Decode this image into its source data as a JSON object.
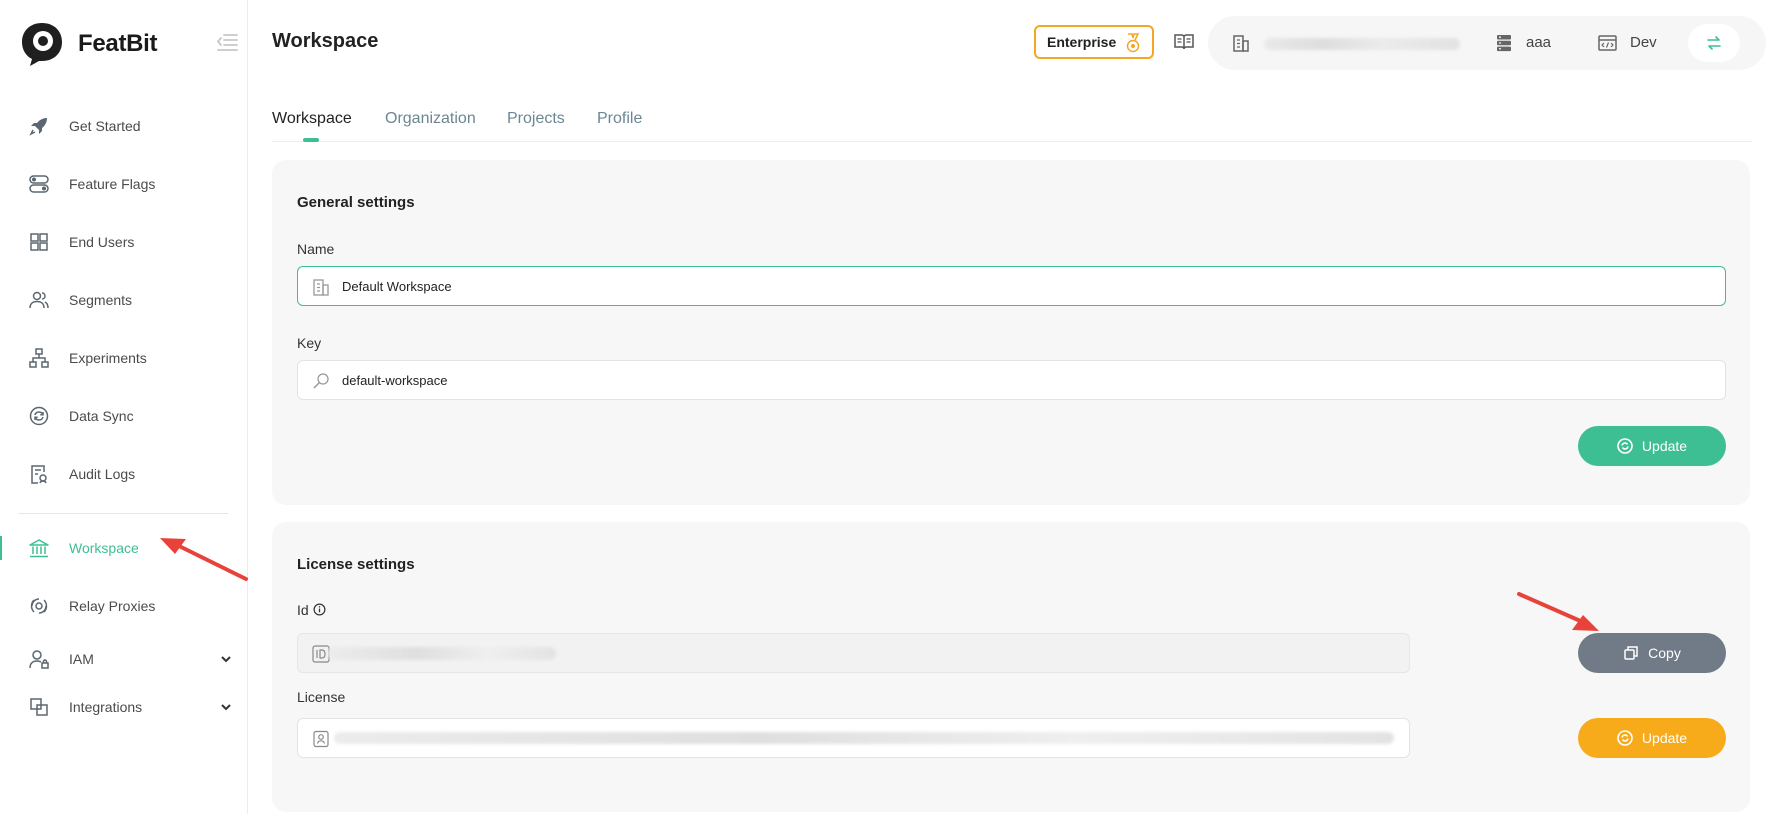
{
  "app": {
    "name": "FeatBit"
  },
  "sidebar": {
    "items": [
      {
        "label": "Get Started",
        "icon": "rocket-icon"
      },
      {
        "label": "Feature Flags",
        "icon": "toggle-icon"
      },
      {
        "label": "End Users",
        "icon": "grid-icon"
      },
      {
        "label": "Segments",
        "icon": "users-icon"
      },
      {
        "label": "Experiments",
        "icon": "hierarchy-icon"
      },
      {
        "label": "Data Sync",
        "icon": "sync-icon"
      },
      {
        "label": "Audit Logs",
        "icon": "audit-icon"
      },
      {
        "label": "Workspace",
        "icon": "bank-icon",
        "active": true
      },
      {
        "label": "Relay Proxies",
        "icon": "relay-icon"
      },
      {
        "label": "IAM",
        "icon": "user-lock-icon",
        "expandable": true
      },
      {
        "label": "Integrations",
        "icon": "integrations-icon",
        "expandable": true
      }
    ]
  },
  "header": {
    "title": "Workspace",
    "plan_badge": "Enterprise",
    "context": {
      "project": "aaa",
      "environment": "Dev"
    }
  },
  "tabs": [
    {
      "label": "Workspace",
      "active": true
    },
    {
      "label": "Organization"
    },
    {
      "label": "Projects"
    },
    {
      "label": "Profile"
    }
  ],
  "general": {
    "title": "General settings",
    "name_label": "Name",
    "name_value": "Default Workspace",
    "key_label": "Key",
    "key_value": "default-workspace",
    "update_label": "Update"
  },
  "license": {
    "title": "License settings",
    "id_label": "Id",
    "copy_label": "Copy",
    "license_label": "License",
    "update_label": "Update"
  },
  "colors": {
    "accent": "#3dbf93",
    "enterprise": "#f5a623",
    "copy_button": "#707b87",
    "license_update": "#f7ab1b",
    "annotation": "#e8433a"
  }
}
